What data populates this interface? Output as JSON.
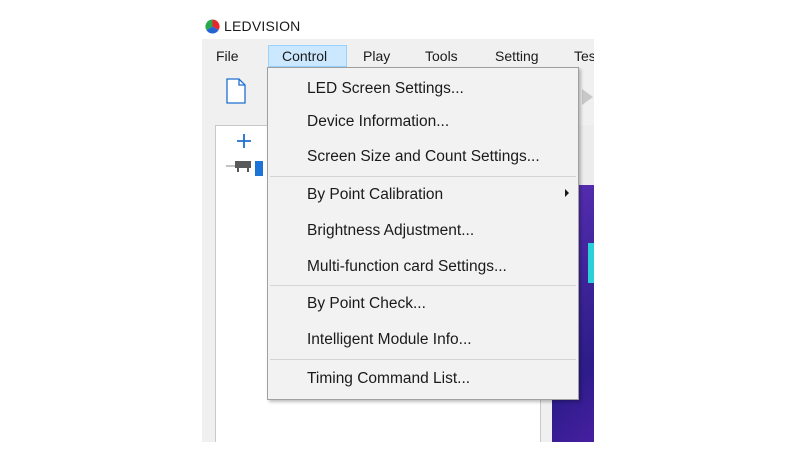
{
  "app": {
    "title": "LEDVISION",
    "logo_colors": [
      "#e8262b",
      "#2aa84a",
      "#2463d4"
    ]
  },
  "menubar": {
    "items": [
      {
        "label": "File"
      },
      {
        "label": "Control",
        "active": true
      },
      {
        "label": "Play"
      },
      {
        "label": "Tools"
      },
      {
        "label": "Setting"
      },
      {
        "label": "Tes"
      }
    ]
  },
  "toolbar": {
    "icons": [
      "new-file-icon",
      "arrow-right-icon"
    ]
  },
  "tree": {
    "add_icon": "add-icon",
    "node_icon": "device-icon"
  },
  "control_menu": {
    "items": [
      {
        "label": "LED Screen Settings..."
      },
      {
        "label": "Device Information..."
      },
      {
        "label": "Screen Size and Count Settings..."
      },
      {
        "label": "By Point Calibration",
        "has_submenu": true
      },
      {
        "label": "Brightness Adjustment..."
      },
      {
        "label": "Multi-function card Settings..."
      },
      {
        "label": "By Point Check..."
      },
      {
        "label": "Intelligent Module Info..."
      },
      {
        "label": "Timing Command List..."
      }
    ]
  },
  "colors": {
    "menu_active_bg": "#cce8ff",
    "menu_active_border": "#99d1ff",
    "selection": "#1e73d6",
    "preview": "#3b2396"
  }
}
